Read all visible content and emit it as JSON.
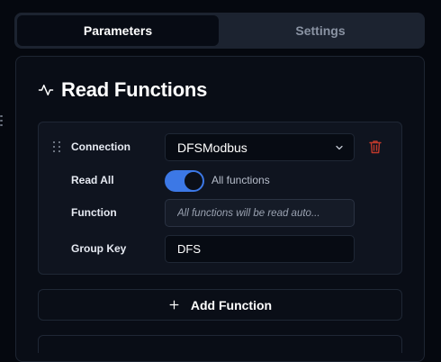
{
  "tabs": [
    {
      "label": "Parameters",
      "active": true
    },
    {
      "label": "Settings",
      "active": false
    }
  ],
  "section": {
    "title": "Read Functions",
    "icon": "activity-icon"
  },
  "function_card": {
    "connection": {
      "label": "Connection",
      "value": "DFSModbus",
      "icon": "chevron-down-icon"
    },
    "delete_icon": "trash-icon",
    "delete_color": "#c0392b",
    "read_all": {
      "label": "Read All",
      "enabled": true,
      "status_text": "All functions",
      "accent": "#3c78e6"
    },
    "function": {
      "label": "Function",
      "placeholder": "All functions will be read auto..."
    },
    "group_key": {
      "label": "Group Key",
      "value": "DFS"
    }
  },
  "add_function": {
    "label": "Add Function",
    "icon": "plus-icon"
  }
}
